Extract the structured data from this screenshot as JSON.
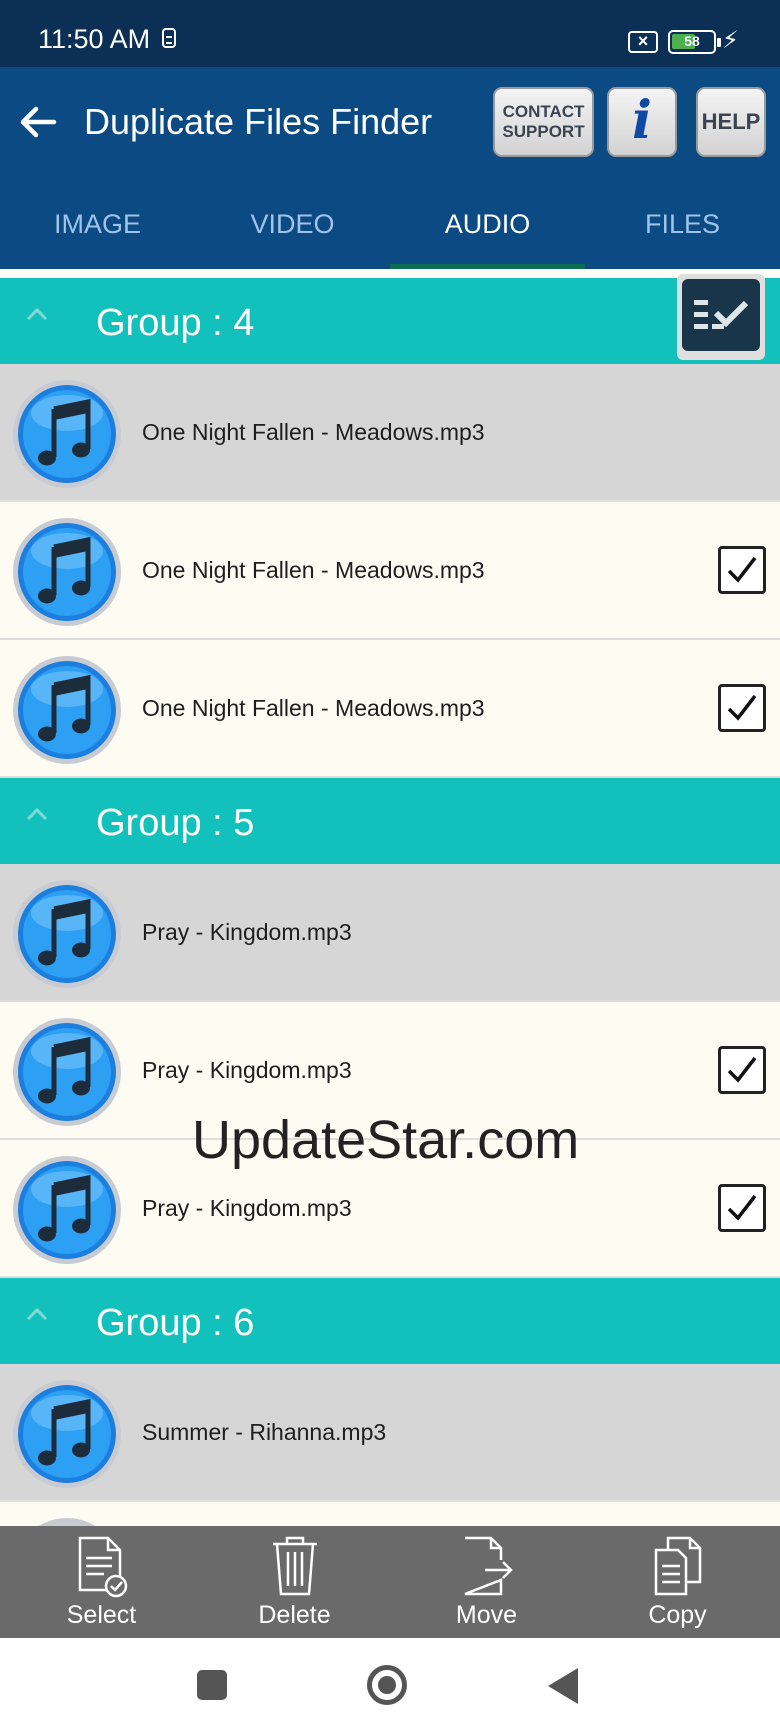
{
  "status_bar": {
    "time": "11:50 AM",
    "battery": "58",
    "battery_level": 0.58
  },
  "app_bar": {
    "title": "Duplicate Files Finder",
    "contact_line1": "CONTACT",
    "contact_line2": "SUPPORT",
    "info_label": "i",
    "help_label": "HELP"
  },
  "tabs": [
    {
      "label": "IMAGE",
      "active": false
    },
    {
      "label": "VIDEO",
      "active": false
    },
    {
      "label": "AUDIO",
      "active": true
    },
    {
      "label": "FILES",
      "active": false
    }
  ],
  "groups": [
    {
      "label": "Group : 4",
      "files": [
        {
          "name": "One Night Fallen - Meadows.mp3",
          "checked": false
        },
        {
          "name": "One Night Fallen - Meadows.mp3",
          "checked": true
        },
        {
          "name": "One Night Fallen - Meadows.mp3",
          "checked": true
        }
      ]
    },
    {
      "label": "Group : 5",
      "files": [
        {
          "name": "Pray - Kingdom.mp3",
          "checked": false
        },
        {
          "name": "Pray - Kingdom.mp3",
          "checked": true
        },
        {
          "name": "Pray - Kingdom.mp3",
          "checked": true
        }
      ]
    },
    {
      "label": "Group : 6",
      "files": [
        {
          "name": "Summer - Rihanna.mp3",
          "checked": false
        }
      ]
    }
  ],
  "watermark": "UpdateStar.com",
  "toolbar": {
    "select_label": "Select",
    "delete_label": "Delete",
    "move_label": "Move",
    "copy_label": "Copy"
  },
  "colors": {
    "status_bar": "#0b2f55",
    "app_bar": "#0b4a82",
    "group_header": "#13c1bc",
    "original_row": "#d6d6d6",
    "duplicate_row": "#fcfcf3",
    "toolbar": "#6a6a6a"
  }
}
